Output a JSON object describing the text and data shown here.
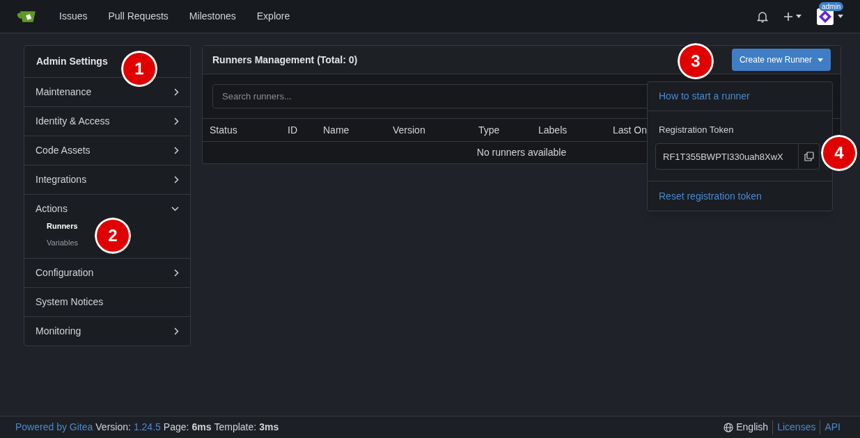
{
  "nav": {
    "items": [
      "Issues",
      "Pull Requests",
      "Milestones",
      "Explore"
    ],
    "user_badge": "admin"
  },
  "sidebar": {
    "title": "Admin Settings",
    "items": [
      {
        "label": "Maintenance",
        "kind": "group",
        "expanded": false
      },
      {
        "label": "Identity & Access",
        "kind": "group",
        "expanded": false
      },
      {
        "label": "Code Assets",
        "kind": "group",
        "expanded": false
      },
      {
        "label": "Integrations",
        "kind": "group",
        "expanded": false
      },
      {
        "label": "Actions",
        "kind": "group",
        "expanded": true,
        "children": [
          {
            "label": "Runners",
            "selected": true
          },
          {
            "label": "Variables",
            "selected": false
          }
        ]
      },
      {
        "label": "Configuration",
        "kind": "group",
        "expanded": false
      },
      {
        "label": "System Notices",
        "kind": "link"
      },
      {
        "label": "Monitoring",
        "kind": "group",
        "expanded": false
      }
    ]
  },
  "panel": {
    "title": "Runners Management (Total: 0)",
    "button": "Create new Runner",
    "search": {
      "placeholder": "Search runners..."
    },
    "table": {
      "columns": [
        "Status",
        "ID",
        "Name",
        "Version",
        "Type",
        "Labels",
        "Last On"
      ],
      "empty": "No runners available"
    }
  },
  "dropdown": {
    "link": "How to start a runner",
    "token_label": "Registration Token",
    "token": "RF1T355BWPTI330uah8XwX",
    "reset": "Reset registration token"
  },
  "footer": {
    "powered": "Powered by Gitea",
    "version_label": "Version:",
    "version": "1.24.5",
    "page_label": "Page:",
    "page": "6ms",
    "template_label": "Template:",
    "template": "3ms",
    "language": "English",
    "links": [
      "Licenses",
      "API"
    ]
  },
  "annotations": [
    {
      "label": "1"
    },
    {
      "label": "2"
    },
    {
      "label": "3"
    },
    {
      "label": "4"
    }
  ]
}
